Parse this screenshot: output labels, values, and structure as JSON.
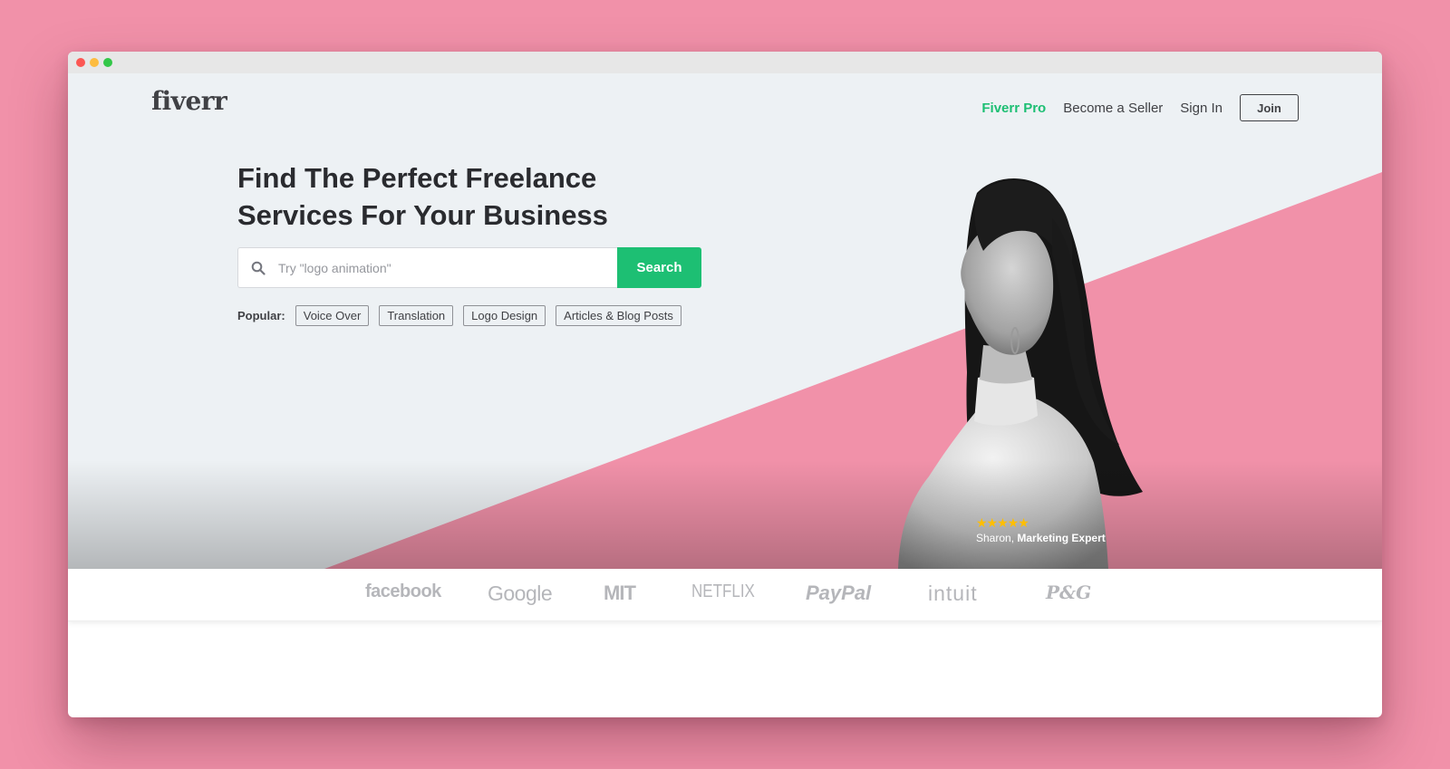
{
  "header": {
    "logo": "fiverr",
    "nav": {
      "pro": "Fiverr Pro",
      "seller": "Become a Seller",
      "signin": "Sign In",
      "join": "Join"
    }
  },
  "hero": {
    "headline": "Find The Perfect Freelance Services For Your Business",
    "search": {
      "placeholder": "Try \"logo animation\"",
      "button": "Search"
    },
    "popular": {
      "label": "Popular:",
      "tags": [
        "Voice Over",
        "Translation",
        "Logo Design",
        "Articles & Blog Posts"
      ]
    },
    "seller": {
      "rating_stars": 5,
      "stars": "★★★★★",
      "name": "Sharon,",
      "title": "Marketing Expert"
    }
  },
  "trusted_by": {
    "brands": [
      "facebook",
      "Google",
      "MIT",
      "NETFLIX",
      "PayPal",
      "intuit",
      "P&G"
    ]
  },
  "colors": {
    "page_background": "#f191a9",
    "hero_background": "#edf1f4",
    "accent_green": "#1dbf73",
    "pink_wedge": "#f191a9",
    "star_yellow": "#ffbe00"
  },
  "icons": [
    "search-icon"
  ]
}
